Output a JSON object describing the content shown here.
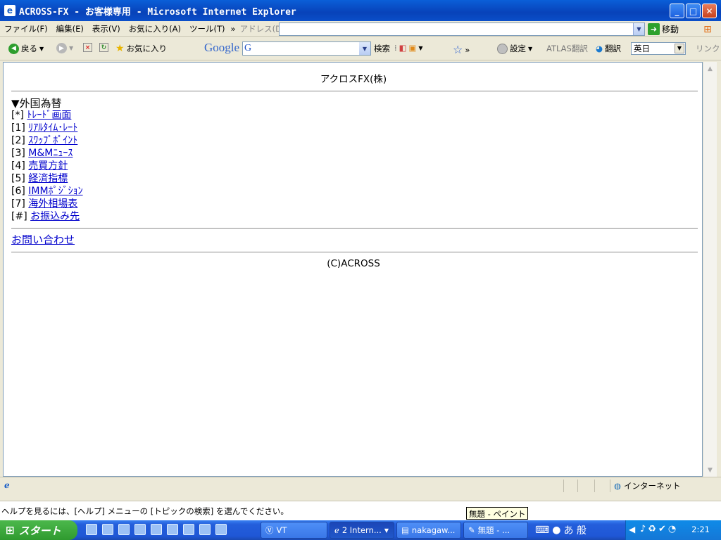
{
  "window": {
    "title": "ACROSS-FX - お客様専用 - Microsoft Internet Explorer",
    "minimize": "_",
    "maximize": "□",
    "close": "✕"
  },
  "menu": {
    "items": [
      "ファイル(F)",
      "編集(E)",
      "表示(V)",
      "お気に入り(A)",
      "ツール(T)"
    ],
    "chevron": "»",
    "address_label": "アドレス(D)",
    "address_value": "",
    "go_label": "移動"
  },
  "toolbar": {
    "back": "戻る",
    "favorites": "お気に入り",
    "google_logo": "Google",
    "google_g": "G",
    "search_value": "",
    "search_label": "検索",
    "chevron": "»",
    "settings": "設定",
    "atlas": "ATLAS翻訳",
    "translate": "翻訳",
    "lang_value": "英日",
    "links": "リンク"
  },
  "page": {
    "title": "アクロスFX(株)",
    "section": "▼外国為替",
    "links": [
      {
        "key": "[*]",
        "label": "ﾄﾚｰﾄﾞ画面"
      },
      {
        "key": "[1]",
        "label": "ﾘｱﾙﾀｲﾑ･ﾚｰﾄ"
      },
      {
        "key": "[2]",
        "label": "ｽﾜｯﾌﾟﾎﾟｲﾝﾄ"
      },
      {
        "key": "[3]",
        "label": "M&Mﾆｭｰｽ"
      },
      {
        "key": "[4]",
        "label": "売買方針"
      },
      {
        "key": "[5]",
        "label": "経済指標"
      },
      {
        "key": "[6]",
        "label": "IMMﾎﾟｼﾞｼｮﾝ"
      },
      {
        "key": "[7]",
        "label": "海外相場表"
      },
      {
        "key": "[#]",
        "label": "お振込み先"
      }
    ],
    "contact": "お問い合わせ",
    "copyright": "(C)ACROSS"
  },
  "status": {
    "zone": "インターネット"
  },
  "help_text": "ヘルプを見るには、[ヘルプ] メニューの [トピックの検索] を選んでください。",
  "tooltip": "無題 - ペイント",
  "taskbar": {
    "start": "スタート",
    "tasks": [
      {
        "label": "VT",
        "active": false
      },
      {
        "label": "2 Intern...",
        "active": true
      },
      {
        "label": "nakagaw...",
        "active": false
      },
      {
        "label": "無題 - ...",
        "active": false
      }
    ],
    "ime": "あ 般",
    "clock": "2:21"
  },
  "colors": {
    "link": "#0000cc",
    "titlebar": "#0842b9",
    "taskbar": "#245edb",
    "start": "#2f9a2f"
  }
}
